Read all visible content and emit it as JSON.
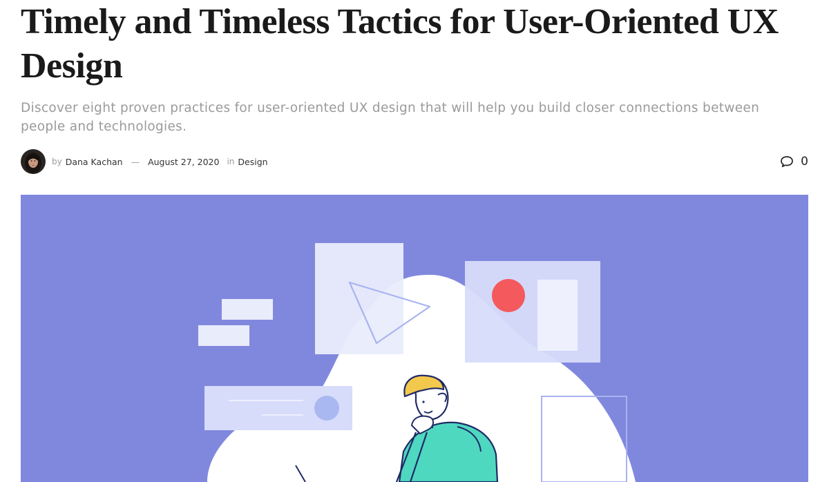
{
  "article": {
    "title": "Timely and Timeless Tactics for User-Oriented UX Design",
    "subtitle": "Discover eight proven practices for user-oriented UX design that will help you build closer connections between people and technologies.",
    "by_label": "by",
    "author": "Dana Kachan",
    "separator": "—",
    "date": "August 27, 2020",
    "in_label": "in",
    "category": "Design",
    "comment_count": "0",
    "comment_icon": "speech-bubble-icon"
  },
  "colors": {
    "hero_background": "#8088de",
    "accent_red": "#f4595e",
    "character_shirt": "#4fd8c0",
    "character_hair": "#f2c94c"
  }
}
